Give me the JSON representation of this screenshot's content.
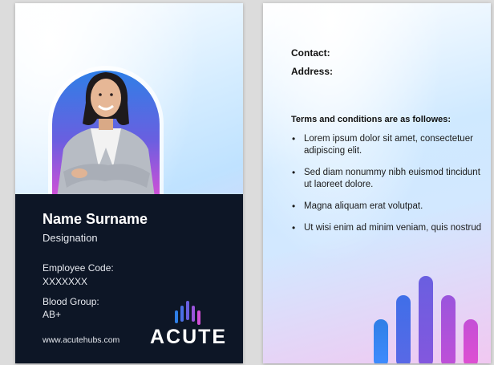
{
  "front": {
    "name": "Name Surname",
    "designation": "Designation",
    "employee_code_label": "Employee Code:",
    "employee_code_value": "XXXXXXX",
    "blood_group_label": "Blood Group:",
    "blood_group_value": "AB+",
    "website": "www.acutehubs.com",
    "logo_text": "ACUTE"
  },
  "back": {
    "contact_label": "Contact:",
    "address_label": "Address:",
    "terms_title": "Terms and conditions are as followes:",
    "terms": [
      "Lorem ipsum dolor sit amet, consectetuer adipiscing elit.",
      "Sed diam nonummy nibh euismod tincidunt ut laoreet dolore.",
      "Magna aliquam erat volutpat.",
      "Ut wisi enim ad minim veniam, quis nostrud"
    ]
  },
  "colors": {
    "panel": "#0d1626",
    "accent_blue": "#2f7fe6",
    "accent_purple": "#7b4fe0",
    "accent_pink": "#d24fd6"
  }
}
